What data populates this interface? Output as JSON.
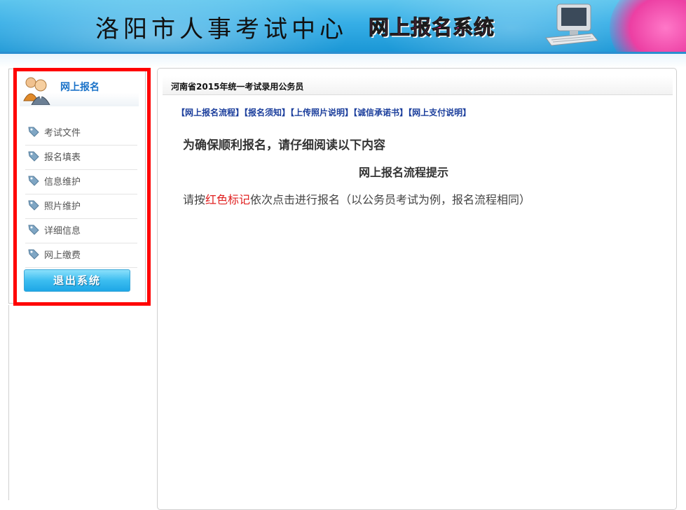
{
  "header": {
    "title": "洛阳市人事考试中心",
    "subtitle": "网上报名系统"
  },
  "sidebar": {
    "section_title": "网上报名",
    "items": [
      {
        "label": "考试文件",
        "icon": "tag-icon"
      },
      {
        "label": "报名填表",
        "icon": "tag-icon"
      },
      {
        "label": "信息维护",
        "icon": "tag-icon"
      },
      {
        "label": "照片维护",
        "icon": "tag-icon"
      },
      {
        "label": "详细信息",
        "icon": "tag-icon"
      },
      {
        "label": "网上缴费",
        "icon": "tag-icon"
      }
    ],
    "logout_label": "退出系统"
  },
  "main": {
    "panel_title": "河南省2015年统一考试录用公务员",
    "links": [
      "【网上报名流程】",
      "【报名须知】",
      "【上传照片说明】",
      "【诚信承诺书】",
      "【网上支付说明】"
    ],
    "heading": "为确保顺利报名，请仔细阅读以下内容",
    "subheading": "网上报名流程提示",
    "instruction_prefix": "请按",
    "instruction_highlight": "红色标记",
    "instruction_suffix": "依次点击进行报名（以公务员考试为例，报名流程相同）"
  },
  "colors": {
    "accent_blue": "#2b8fd0",
    "highlight_red": "#ff0000",
    "link_blue": "#1b3e9c",
    "subtitle_pink": "#ff2ba1"
  }
}
